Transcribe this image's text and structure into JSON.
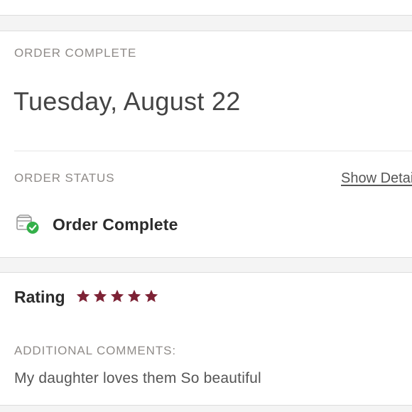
{
  "order": {
    "heading": "ORDER COMPLETE",
    "date": "Tuesday, August 22",
    "status_label": "ORDER STATUS",
    "show_details_label": "Show Details",
    "status_text": "Order Complete",
    "status_icon": "package-check-icon"
  },
  "rating": {
    "label": "Rating",
    "stars": 5,
    "max_stars": 5,
    "comments_label": "ADDITIONAL COMMENTS:",
    "comments": "My daughter loves them So beautiful"
  },
  "colors": {
    "star": "#7d2235",
    "check": "#34b04a",
    "eyebrow_text": "#8f8b88"
  }
}
